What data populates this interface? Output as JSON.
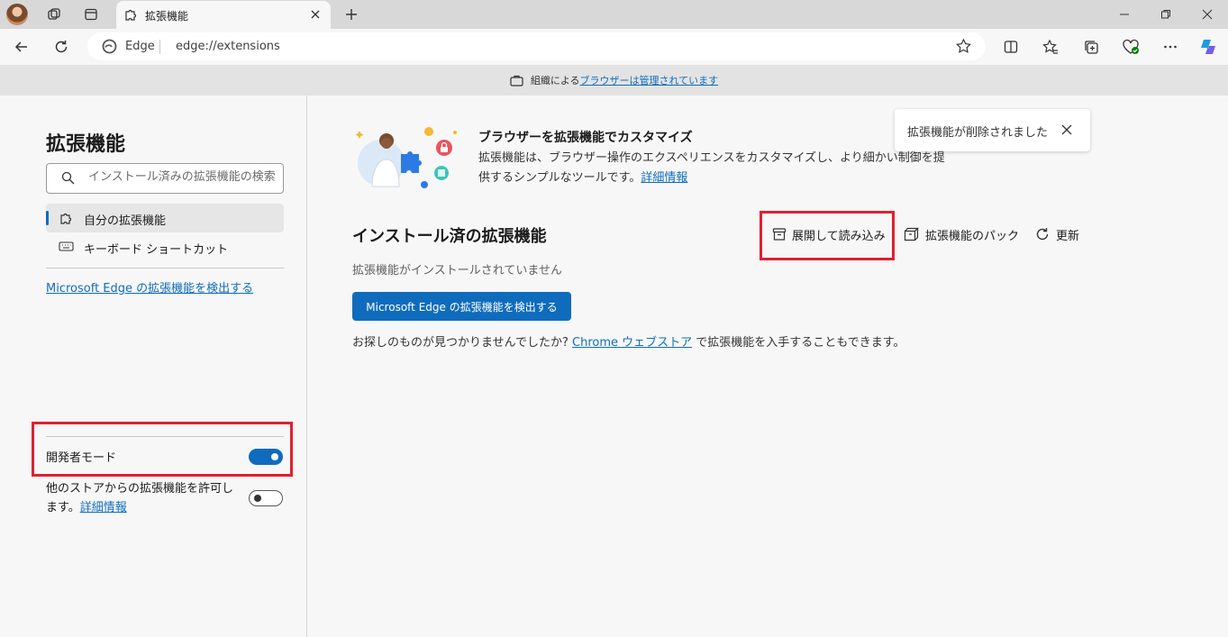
{
  "tab": {
    "title": "拡張機能"
  },
  "address": {
    "site_name": "Edge",
    "url": "edge://extensions"
  },
  "managed_banner": {
    "prefix": "組織による",
    "link": "ブラウザーは管理されています"
  },
  "sidebar": {
    "title": "拡張機能",
    "search_placeholder": "インストール済みの拡張機能の検索",
    "nav": [
      {
        "label": "自分の拡張機能",
        "icon": "puzzle-icon"
      },
      {
        "label": "キーボード ショートカット",
        "icon": "keyboard-icon"
      }
    ],
    "discover_link": "Microsoft Edge の拡張機能を検出する",
    "developer_mode": {
      "label": "開発者モード",
      "enabled": true
    },
    "other_stores": {
      "label": "他のストアからの拡張機能を許可します。",
      "link": "詳細情報",
      "enabled": false
    }
  },
  "promo": {
    "title": "ブラウザーを拡張機能でカスタマイズ",
    "desc": "拡張機能は、ブラウザー操作のエクスペリエンスをカスタマイズし、より細かい制御を提供するシンプルなツールです。",
    "link": "詳細情報"
  },
  "toast": {
    "text": "拡張機能が削除されました"
  },
  "installed": {
    "title": "インストール済の拡張機能",
    "actions": [
      {
        "label": "展開して読み込み",
        "icon": "archive-icon"
      },
      {
        "label": "拡張機能のパック",
        "icon": "pack-icon"
      },
      {
        "label": "更新",
        "icon": "refresh-icon"
      }
    ],
    "empty_text": "拡張機能がインストールされていません",
    "discover_button": "Microsoft Edge の拡張機能を検出する",
    "not_found_prefix": "お探しのものが見つかりませんでしたか?",
    "chrome_link": "Chrome ウェブストア",
    "not_found_suffix": "で拡張機能を入手することもできます。"
  },
  "colors": {
    "accent": "#0f6cbd",
    "highlight": "#e0202f"
  }
}
